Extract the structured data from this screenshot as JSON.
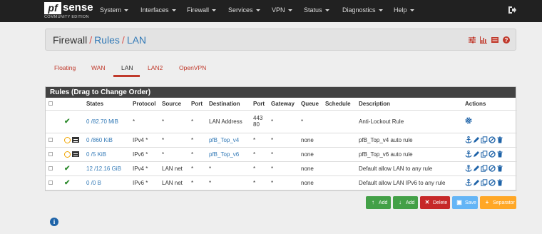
{
  "brand": {
    "logo_main": "pf",
    "logo_rest": "sense",
    "edition": "COMMUNITY EDITION"
  },
  "nav": [
    {
      "label": "System"
    },
    {
      "label": "Interfaces"
    },
    {
      "label": "Firewall"
    },
    {
      "label": "Services"
    },
    {
      "label": "VPN"
    },
    {
      "label": "Status"
    },
    {
      "label": "Diagnostics"
    },
    {
      "label": "Help"
    }
  ],
  "breadcrumb": {
    "part1": "Firewall",
    "part2": "Rules",
    "part3": "LAN",
    "sep": "/"
  },
  "tabs": [
    {
      "label": "Floating"
    },
    {
      "label": "WAN"
    },
    {
      "label": "LAN"
    },
    {
      "label": "LAN2"
    },
    {
      "label": "OpenVPN"
    }
  ],
  "panel": {
    "title": "Rules (Drag to Change Order)"
  },
  "columns": [
    "States",
    "Protocol",
    "Source",
    "Port",
    "Destination",
    "Port",
    "Gateway",
    "Queue",
    "Schedule",
    "Description",
    "Actions"
  ],
  "rows": [
    {
      "states": "0 /82.70 MiB",
      "protocol": "*",
      "source": "*",
      "sport": "*",
      "destination": "LAN Address",
      "dport_line1": "443",
      "dport_line2": "80",
      "gateway": "*",
      "queue": "*",
      "schedule": "",
      "description": "Anti-Lockout Rule"
    },
    {
      "states": "0 /860 KiB",
      "protocol": "IPv4 *",
      "source": "*",
      "sport": "*",
      "destination": "pfB_Top_v4",
      "dport": "*",
      "gateway": "*",
      "queue": "none",
      "schedule": "",
      "description": "pfB_Top_v4 auto rule"
    },
    {
      "states": "0 /5 KiB",
      "protocol": "IPv6 *",
      "source": "*",
      "sport": "*",
      "destination": "pfB_Top_v6",
      "dport": "*",
      "gateway": "*",
      "queue": "none",
      "schedule": "",
      "description": "pfB_Top_v6 auto rule"
    },
    {
      "states": "12 /12.16 GiB",
      "protocol": "IPv4 *",
      "source": "LAN net",
      "sport": "*",
      "destination": "*",
      "dport": "*",
      "gateway": "*",
      "queue": "none",
      "schedule": "",
      "description": "Default allow LAN to any rule"
    },
    {
      "states": "0 /0 B",
      "protocol": "IPv6 *",
      "source": "LAN net",
      "sport": "*",
      "destination": "*",
      "dport": "*",
      "gateway": "*",
      "queue": "none",
      "schedule": "",
      "description": "Default allow LAN IPv6 to any rule"
    }
  ],
  "buttons": {
    "add_top": "Add",
    "add_bottom": "Add",
    "delete": "Delete",
    "save": "Save",
    "separator": "Separator"
  },
  "colors": {
    "navbar": "#212121",
    "accent_red": "#c0392b",
    "link": "#337ab7",
    "add": "#43a047",
    "delete": "#c62828",
    "save": "#64b5f6",
    "separator": "#ffa726"
  }
}
